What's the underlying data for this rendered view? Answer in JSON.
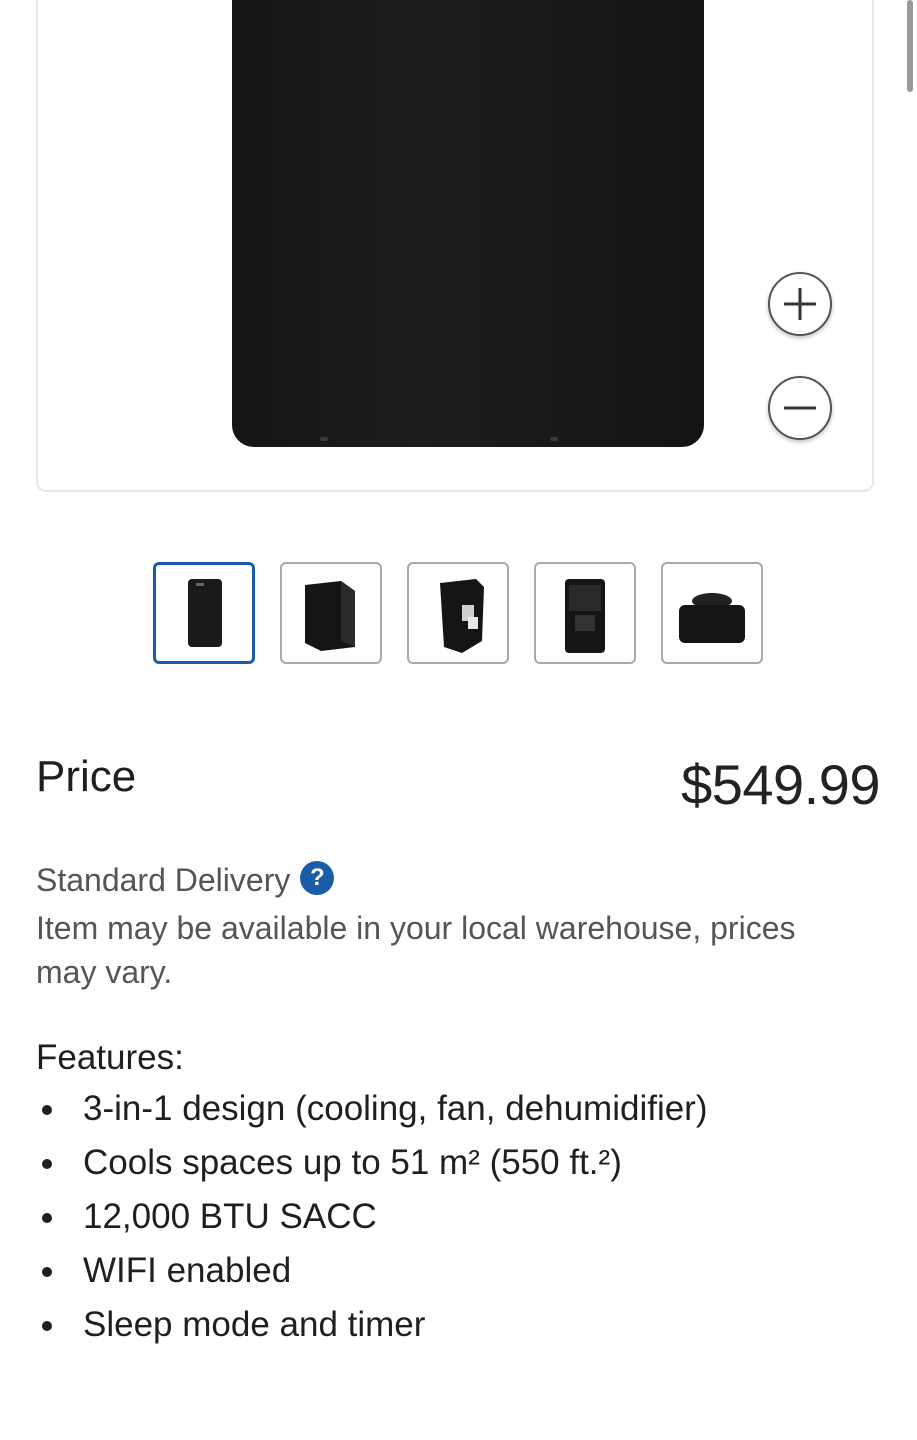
{
  "product": {
    "thumbnail_count": 5,
    "selected_thumbnail": 1
  },
  "zoom": {
    "zoom_in_icon": "plus-icon",
    "zoom_out_icon": "minus-icon"
  },
  "price": {
    "label": "Price",
    "value": "$549.99"
  },
  "delivery": {
    "label": "Standard Delivery",
    "help_icon": "?",
    "availability_note": "Item may be available in your local warehouse, prices may vary."
  },
  "features": {
    "title": "Features:",
    "items": [
      "3-in-1 design (cooling, fan, dehumidifier)",
      "Cools spaces up to 51 m² (550 ft.²)",
      "12,000 BTU SACC",
      "WIFI enabled",
      "Sleep mode and timer"
    ]
  },
  "colors": {
    "accent": "#1b5ca8",
    "text": "#1f1f1f",
    "muted_text": "#555555",
    "border": "#a9a9a9"
  }
}
